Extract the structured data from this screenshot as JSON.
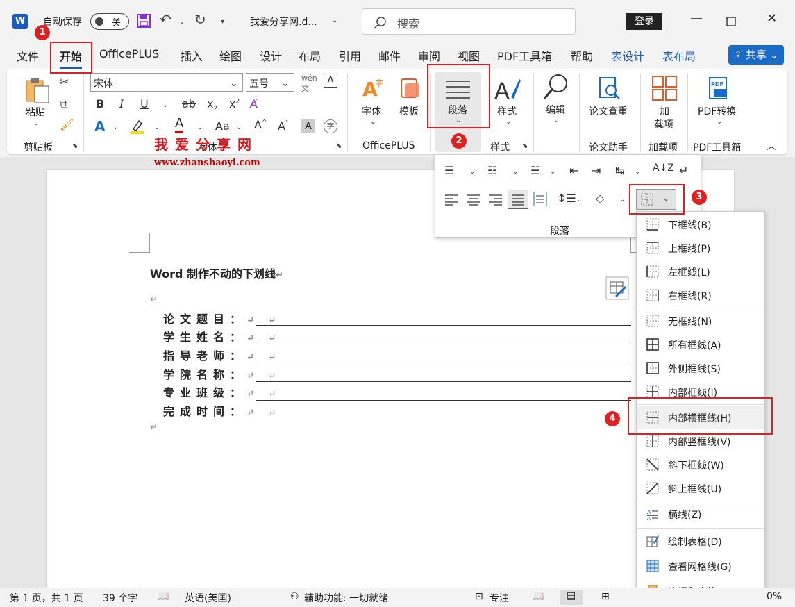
{
  "titlebar": {
    "autosave_label": "自动保存",
    "autosave_state": "关",
    "doc_title": "我爱分享网.d...",
    "search_placeholder": "搜索",
    "login": "登录"
  },
  "tabs": [
    "文件",
    "开始",
    "OfficePLUS",
    "插入",
    "绘图",
    "设计",
    "布局",
    "引用",
    "邮件",
    "审阅",
    "视图",
    "PDF工具箱",
    "帮助",
    "表设计",
    "表布局"
  ],
  "share_label": "共享",
  "ribbon": {
    "paste": "粘贴",
    "clipboard": "剪贴板",
    "font_name": "宋体",
    "font_size": "五号",
    "font_group": "字体",
    "font_btn": "字体",
    "template_btn": "模板",
    "officeplus_group": "OfficePLUS",
    "paragraph_btn": "段落",
    "style_btn": "样式",
    "style_group": "样式",
    "edit_btn": "编辑",
    "paper_check": "论文查重",
    "paper_group": "论文助手",
    "addin_btn_1": "加",
    "addin_btn_2": "载项",
    "addin_group": "加载项",
    "pdf_btn": "PDF转换",
    "pdf_group": "PDF工具箱"
  },
  "paragraph_popup": {
    "label": "段落"
  },
  "document": {
    "heading": "Word 制作不动的下划线",
    "fields": [
      "论文题目：",
      "学生姓名：",
      "指导老师：",
      "学院名称：",
      "专业班级：",
      "完成时间："
    ]
  },
  "border_menu": [
    {
      "label": "下框线(B)",
      "icon": "border-bottom-icon"
    },
    {
      "label": "上框线(P)",
      "icon": "border-top-icon"
    },
    {
      "label": "左框线(L)",
      "icon": "border-left-icon"
    },
    {
      "label": "右框线(R)",
      "icon": "border-right-icon"
    },
    {
      "label": "无框线(N)",
      "icon": "border-none-icon"
    },
    {
      "label": "所有框线(A)",
      "icon": "border-all-icon"
    },
    {
      "label": "外侧框线(S)",
      "icon": "border-outside-icon"
    },
    {
      "label": "内部框线(I)",
      "icon": "border-inside-icon"
    },
    {
      "label": "内部横框线(H)",
      "icon": "border-inside-horizontal-icon"
    },
    {
      "label": "内部竖框线(V)",
      "icon": "border-inside-vertical-icon"
    },
    {
      "label": "斜下框线(W)",
      "icon": "border-diag-down-icon"
    },
    {
      "label": "斜上框线(U)",
      "icon": "border-diag-up-icon"
    },
    {
      "label": "横线(Z)",
      "icon": "horizontal-line-icon"
    },
    {
      "label": "绘制表格(D)",
      "icon": "draw-table-icon"
    },
    {
      "label": "查看网格线(G)",
      "icon": "view-gridlines-icon"
    },
    {
      "label": "边框和底纹(O)...",
      "icon": "borders-shading-icon"
    }
  ],
  "watermark": {
    "cn": "我爱分享网",
    "url": "www.zhanshaoyi.com"
  },
  "badges": [
    "1",
    "2",
    "3",
    "4"
  ],
  "statusbar": {
    "page": "第 1 页，共 1 页",
    "words": "39 个字",
    "lang": "英语(美国)",
    "accessibility": "辅助功能: 一切就绪",
    "focus": "专注",
    "zoom_partial": "0%"
  },
  "colors": {
    "accent": "#185abd",
    "annotation": "#e02020",
    "share": "#1a6ac7"
  }
}
